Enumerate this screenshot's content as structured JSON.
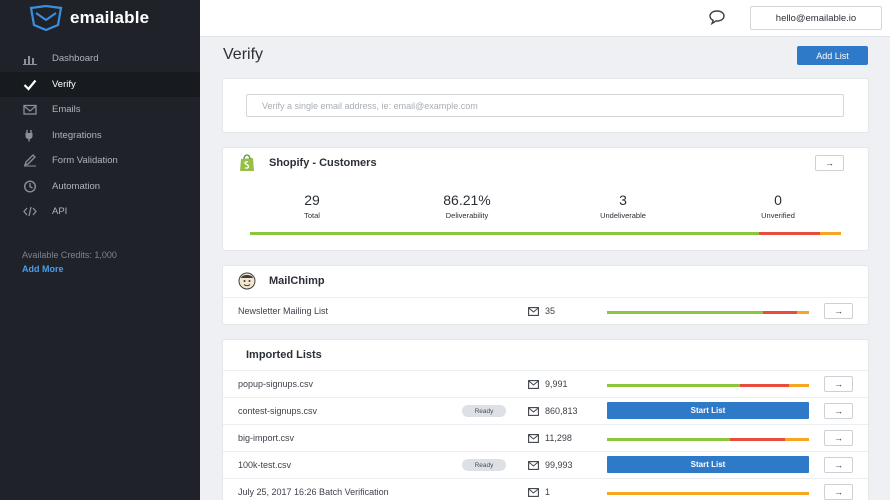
{
  "brand": {
    "name": "emailable"
  },
  "sidebar": {
    "items": [
      {
        "label": "Dashboard",
        "icon": "bar-chart-icon",
        "active": false
      },
      {
        "label": "Verify",
        "icon": "check-icon",
        "active": true
      },
      {
        "label": "Emails",
        "icon": "envelope-icon",
        "active": false
      },
      {
        "label": "Integrations",
        "icon": "plug-icon",
        "active": false
      },
      {
        "label": "Form Validation",
        "icon": "pencil-icon",
        "active": false
      },
      {
        "label": "Automation",
        "icon": "clock-icon",
        "active": false
      },
      {
        "label": "API",
        "icon": "code-icon",
        "active": false
      }
    ],
    "credits": "Available Credits: 1,000",
    "add_more": "Add More"
  },
  "topbar": {
    "user_email": "hello@emailable.io"
  },
  "main": {
    "title": "Verify",
    "add_list_label": "Add List",
    "verify_placeholder": "Verify a single email address, ie: email@example.com",
    "shopify": {
      "title": "Shopify - Customers",
      "stats": [
        {
          "value": "29",
          "label": "Total"
        },
        {
          "value": "86.21%",
          "label": "Deliverability"
        },
        {
          "value": "3",
          "label": "Undeliverable"
        },
        {
          "value": "0",
          "label": "Unverified"
        }
      ],
      "bar": {
        "deliverable": 0.862,
        "undeliverable": 0.103,
        "unknown": 0.035
      }
    },
    "mailchimp": {
      "title": "MailChimp",
      "rows": [
        {
          "name": "Newsletter Mailing List",
          "count": "35",
          "bar": {
            "deliverable": 0.77,
            "undeliverable": 0.17,
            "unknown": 0.06
          }
        }
      ]
    },
    "imported": {
      "title": "Imported Lists",
      "ready_label": "Ready",
      "start_label": "Start List",
      "rows": [
        {
          "name": "popup-signups.csv",
          "count": "9,991",
          "bar": {
            "deliverable": 0.66,
            "undeliverable": 0.24,
            "unknown": 0.1
          }
        },
        {
          "name": "contest-signups.csv",
          "count": "860,813",
          "status": "Ready"
        },
        {
          "name": "big-import.csv",
          "count": "11,298",
          "bar": {
            "deliverable": 0.61,
            "undeliverable": 0.27,
            "unknown": 0.12
          }
        },
        {
          "name": "100k-test.csv",
          "count": "99,993",
          "status": "Ready"
        },
        {
          "name": "July 25, 2017 16:26 Batch Verification",
          "count": "1",
          "bar": {
            "deliverable": 0.0,
            "undeliverable": 0.0,
            "unknown": 1.0
          }
        }
      ]
    }
  },
  "colors": {
    "deliverable": "#8cc63f",
    "undeliverable": "#e74c3c",
    "unknown": "#f5a623",
    "accent": "#2f7ac8"
  }
}
